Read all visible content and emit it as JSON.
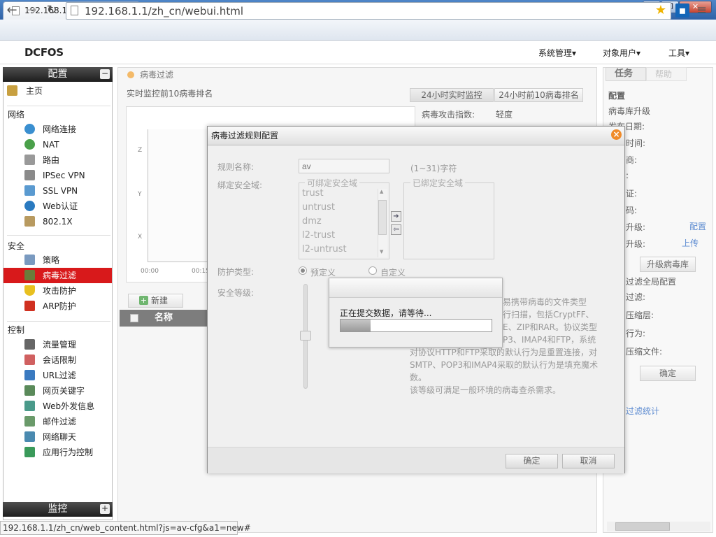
{
  "browser": {
    "tab_title": "192.168.1.1/zh_cn/webui.",
    "tab_close": "×",
    "url": "192.168.1.1/zh_cn/webui.html",
    "status_url": "192.168.1.1/zh_cn/web_content.html?js=av-cfg&a1=new#"
  },
  "app": {
    "logo": "DCFOS",
    "top_menu": [
      "系统管理▾",
      "对象用户▾",
      "工具▾"
    ]
  },
  "sidebar": {
    "config_header": "配置",
    "home": "主页",
    "sections": {
      "network": "网络",
      "security": "安全",
      "control": "控制"
    },
    "network_items": [
      "网络连接",
      "NAT",
      "路由",
      "IPSec VPN",
      "SSL VPN",
      "Web认证",
      "802.1X"
    ],
    "security_items": [
      "策略",
      "病毒过滤",
      "攻击防护",
      "ARP防护"
    ],
    "control_items": [
      "流量管理",
      "会话限制",
      "URL过滤",
      "网页关键字",
      "Web外发信息",
      "邮件过滤",
      "网络聊天",
      "应用行为控制"
    ],
    "monitor_header": "监控",
    "collapse": "−",
    "expand": "+"
  },
  "main": {
    "breadcrumb": "病毒过滤",
    "realtime_title": "实时监控前10病毒排名",
    "tabs": [
      "24小时实时监控",
      "24小时前10病毒排名"
    ],
    "attack_label": "病毒攻击指数:",
    "attack_value": "轻度",
    "chart_y_labels": [
      "Z",
      "Y",
      "X"
    ],
    "chart_x_labels": [
      "00:00",
      "00:15"
    ],
    "new_button": "新建",
    "grid_col_name": "名称"
  },
  "right_panel": {
    "tabs": [
      "任务",
      "帮助"
    ],
    "section": "配置",
    "lines": [
      "病毒库升级",
      "发布日期:",
      "时间:",
      "商:",
      ":",
      "证:",
      "码:",
      "升级:",
      "升级:"
    ],
    "link_config": "配置",
    "link_upload": "上传",
    "upgrade_btn": "升级病毒库",
    "global_title": "过滤全局配置",
    "global_lines": [
      "过滤:",
      "压缩层:",
      "行为:",
      "压缩文件:"
    ],
    "ok_btn": "确定",
    "stats_link": "过滤统计"
  },
  "dialog": {
    "title": "病毒过滤规则配置",
    "close": "×",
    "rule_name_label": "规则名称:",
    "rule_name_value": "av",
    "rule_name_hint": "(1~31)字符",
    "bind_label": "绑定安全域:",
    "available_legend": "可绑定安全域",
    "bound_legend": "已绑定安全域",
    "zones": [
      "trust",
      "untrust",
      "dmz",
      "l2-trust",
      "l2-untrust"
    ],
    "arrow_right": "➔",
    "arrow_left": "⇦",
    "protect_label": "防护类型:",
    "preset": "预定义",
    "custom": "自定义",
    "level_label": "安全等级:",
    "desc_lines": [
      "易携带病毒的文件类型",
      "行扫描，包括CryptFF、",
      "E、ZIP和RAR。协议类型",
      "P3、IMAP4和FTP，系统",
      "对协议HTTP和FTP采取的默认行为是重置连接，对",
      "SMTP、POP3和IMAP4采取的默认行为是填充魔术",
      "数。",
      "该等级可满足一般环境的病毒查杀需求。"
    ],
    "ok": "确定",
    "cancel": "取消"
  },
  "progress": {
    "text": "正在提交数据，请等待...",
    "fraction": 0.2
  },
  "colors": {
    "selected_menu": "#d8191b",
    "accent_orange": "#f08b2a",
    "link_blue": "#2060c0"
  }
}
